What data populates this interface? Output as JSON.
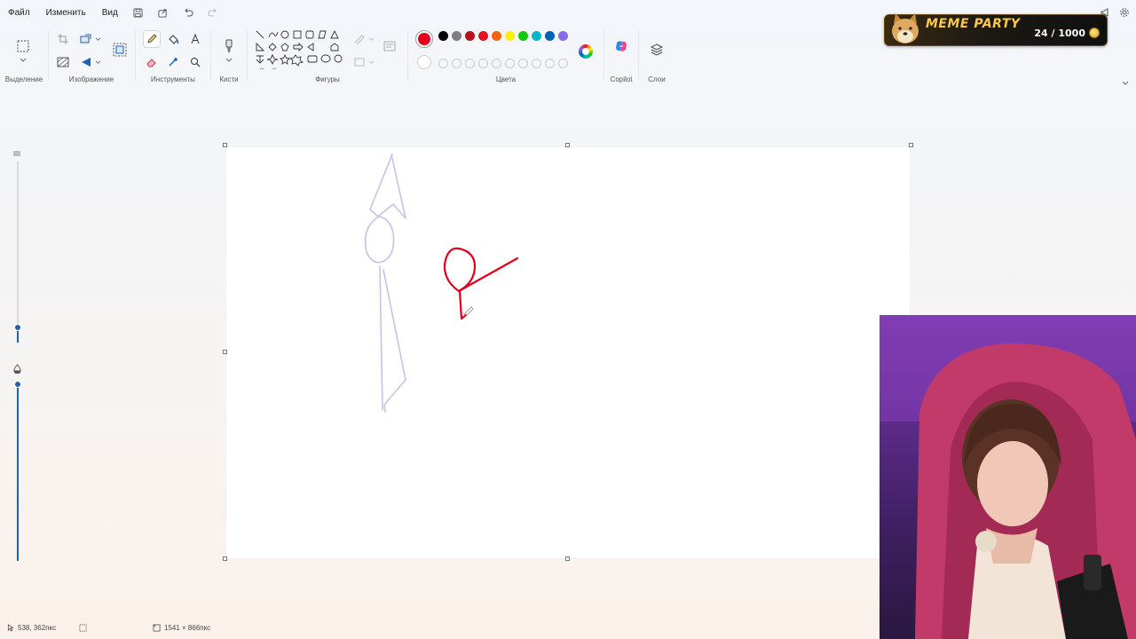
{
  "menu": {
    "file": "Файл",
    "edit": "Изменить",
    "view": "Вид"
  },
  "ribbon": {
    "groups": {
      "selection": "Выделение",
      "image": "Изображение",
      "tools": "Инструменты",
      "brushes": "Кисти",
      "shapes": "Фигуры",
      "colors": "Цвета",
      "copilot": "Copilot",
      "layers": "Слои"
    },
    "active_color": "#e3001b",
    "palette_row1": [
      "#000000",
      "#7f7f7f",
      "#b5121b",
      "#e81123",
      "#f7630c",
      "#fff100",
      "#16c60c",
      "#00b7c3",
      "#0063b1",
      "#886ce4"
    ],
    "palette_row2": [
      "#ffffff",
      "#c3c3c3",
      "#b97a57",
      "#ffaec9",
      "#ffc90e",
      "#efe4b0",
      "#b5e61d",
      "#99d9ea",
      "#7092be",
      "#c8bfe7"
    ]
  },
  "canvas": {
    "stroke_lavender": "#c5c3e6",
    "stroke_red": "#e3001b"
  },
  "status": {
    "cursor_position": "538, 362пкс",
    "canvas_size": "1541 × 866пкс"
  },
  "overlay": {
    "title": "MEME PARTY",
    "counter": "24 / 1000"
  },
  "icons": {
    "save": "save-icon",
    "share": "share-icon",
    "undo": "undo-icon",
    "redo": "redo-icon",
    "settings": "gear-icon",
    "feedback": "megaphone-icon"
  }
}
